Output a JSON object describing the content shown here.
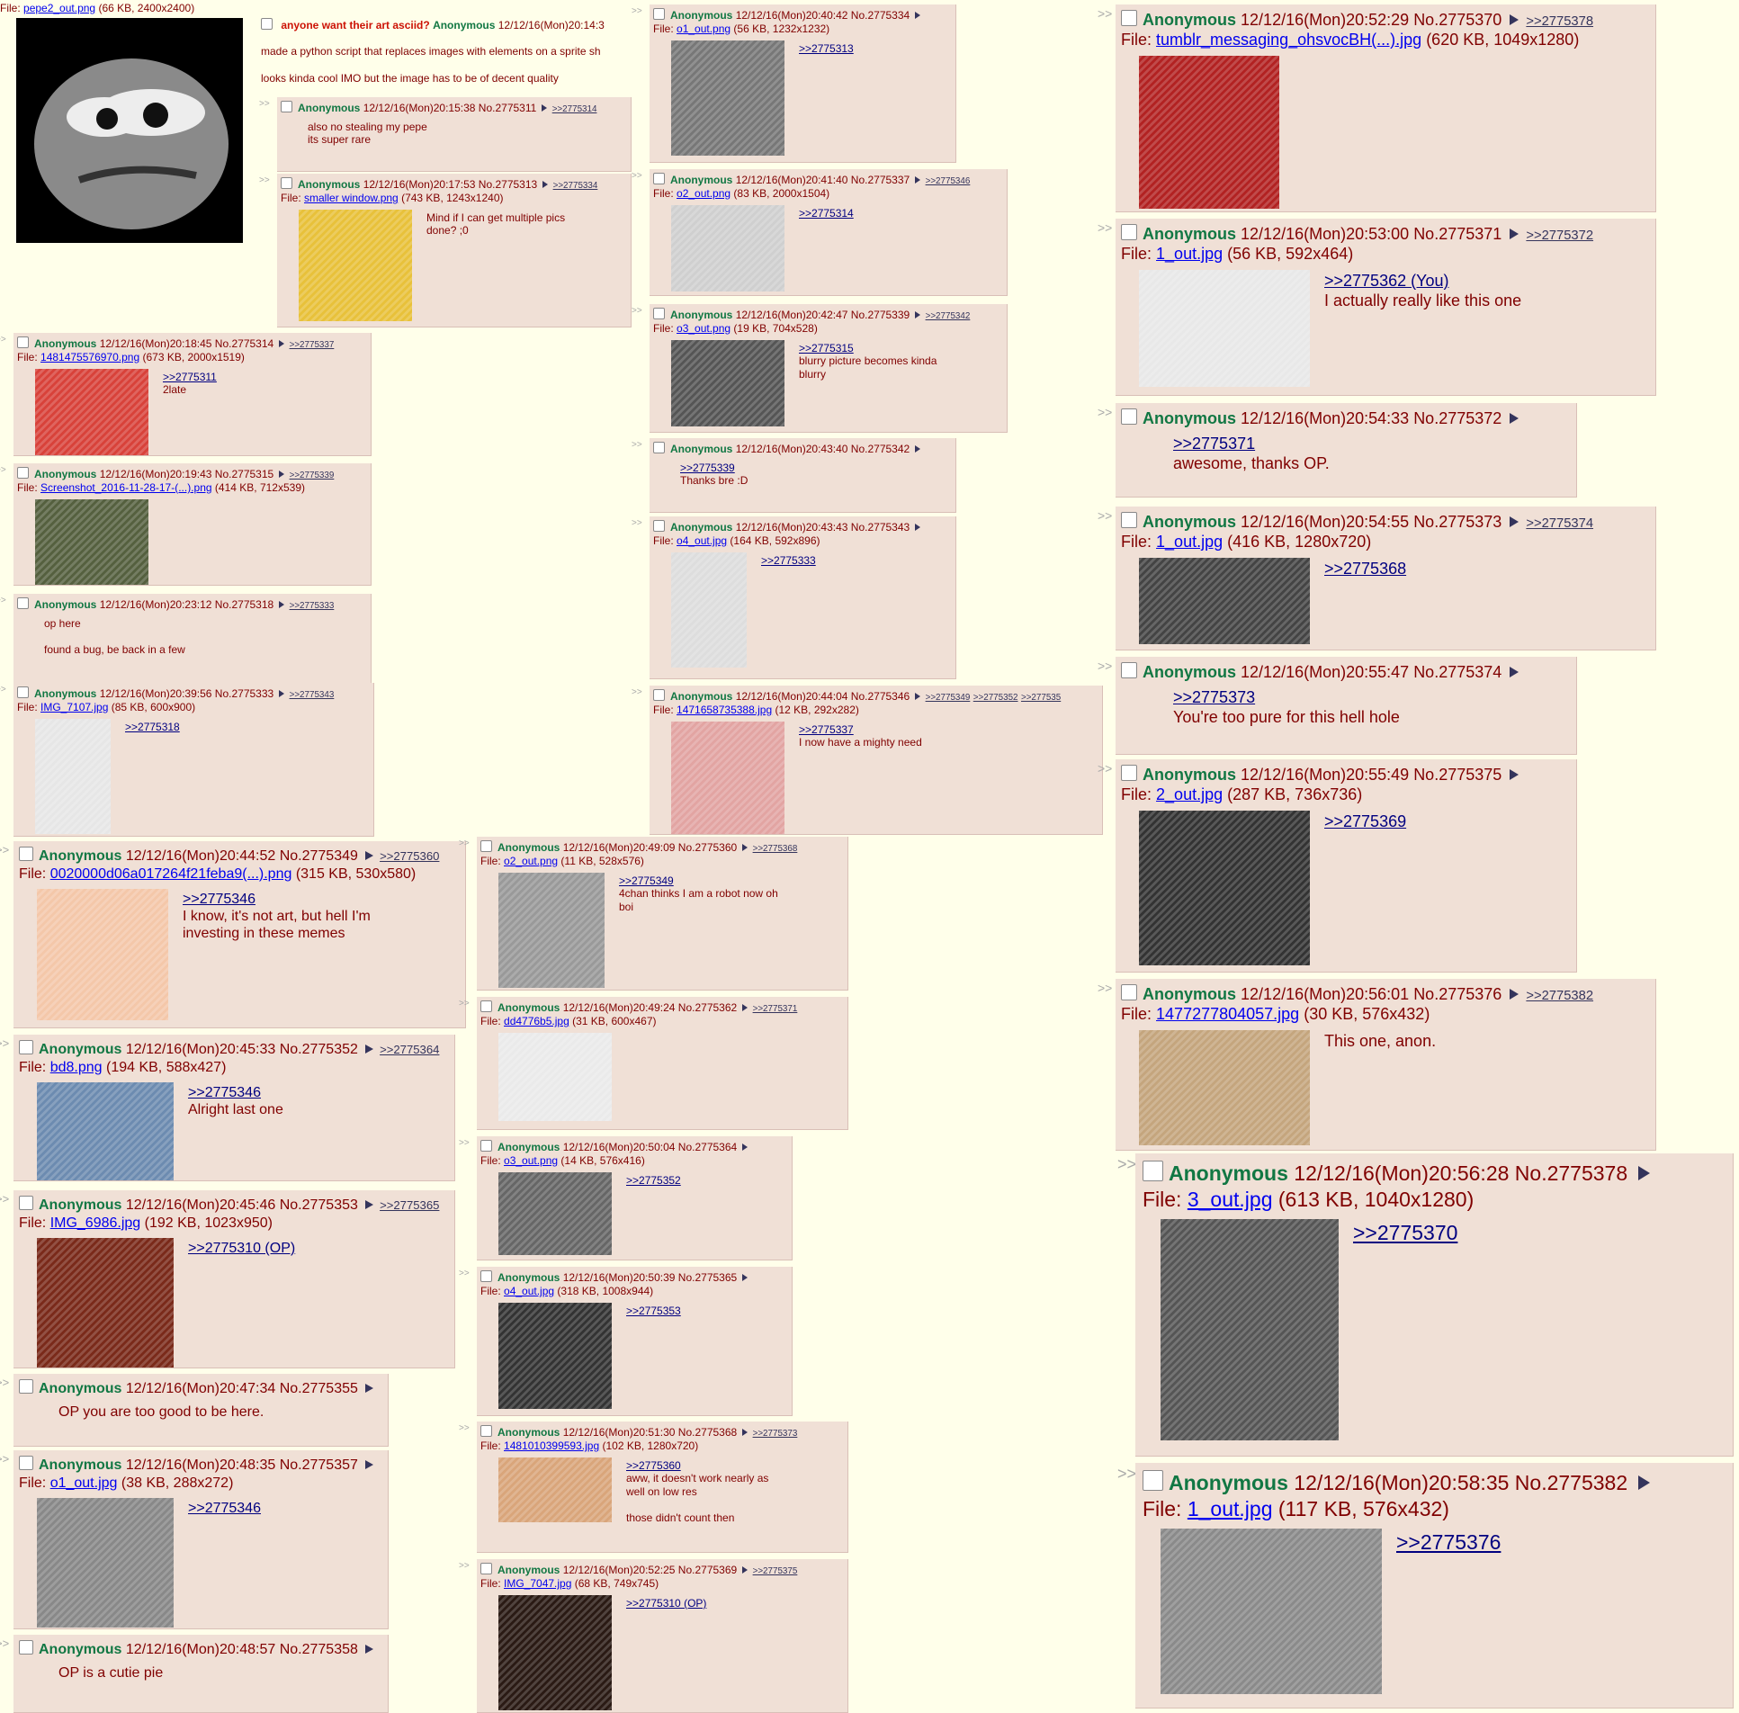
{
  "op": {
    "file_label": "File:",
    "file_name": "pepe2_out.png",
    "file_meta": "(66 KB, 2400x2400)",
    "subject": "anyone want their art asciid?",
    "name": "Anonymous",
    "date": "12/12/16(Mon)20:14:3",
    "lines": [
      "made a python script that replaces images with elements on a sprite sh",
      "looks kinda cool IMO but the image has to be of decent quality"
    ]
  },
  "colors": {
    "post_bg": "#f0e0d6",
    "name": "#117743",
    "text": "#800000",
    "link": "#34345c",
    "file_link": "#0000ee",
    "subject": "#cc1105",
    "page_bg": "#ffffea"
  },
  "posts": [
    {
      "name": "Anonymous",
      "date": "12/12/16(Mon)20:15:38",
      "no": "No.2775311",
      "backlinks": [
        ">>2775314"
      ],
      "file": null,
      "lines": [
        {
          "t": "also no stealing my pepe"
        },
        {
          "t": "its super rare"
        }
      ]
    },
    {
      "name": "Anonymous",
      "date": "12/12/16(Mon)20:17:53",
      "no": "No.2775313",
      "backlinks": [
        ">>2775334"
      ],
      "file": {
        "name": "smaller window.png",
        "meta": "(743 KB, 1243x1240)"
      },
      "lines": [
        {
          "t": "Mind if I can get multiple pics"
        },
        {
          "t": "done? ;0"
        }
      ]
    },
    {
      "name": "Anonymous",
      "date": "12/12/16(Mon)20:18:45",
      "no": "No.2775314",
      "backlinks": [
        ">>2775337"
      ],
      "file": {
        "name": "1481475576970.png",
        "meta": "(673 KB, 2000x1519)"
      },
      "lines": [
        {
          "t": ">>2775311",
          "q": true
        },
        {
          "t": "2late"
        }
      ]
    },
    {
      "name": "Anonymous",
      "date": "12/12/16(Mon)20:19:43",
      "no": "No.2775315",
      "backlinks": [
        ">>2775339"
      ],
      "file": {
        "name": "Screenshot_2016-11-28-17-(...).png",
        "meta": "(414 KB, 712x539)"
      },
      "lines": []
    },
    {
      "name": "Anonymous",
      "date": "12/12/16(Mon)20:23:12",
      "no": "No.2775318",
      "backlinks": [
        ">>2775333"
      ],
      "file": null,
      "lines": [
        {
          "t": "op here"
        },
        {
          "t": ""
        },
        {
          "t": "found a bug, be back in a few"
        }
      ]
    },
    {
      "name": "Anonymous",
      "date": "12/12/16(Mon)20:39:56",
      "no": "No.2775333",
      "backlinks": [
        ">>2775343"
      ],
      "file": {
        "name": "IMG_7107.jpg",
        "meta": "(85 KB, 600x900)"
      },
      "lines": [
        {
          "t": ">>2775318",
          "q": true
        }
      ]
    },
    {
      "name": "Anonymous",
      "date": "12/12/16(Mon)20:40:42",
      "no": "No.2775334",
      "backlinks": [],
      "file": {
        "name": "o1_out.png",
        "meta": "(56 KB, 1232x1232)"
      },
      "lines": [
        {
          "t": ">>2775313",
          "q": true
        }
      ]
    },
    {
      "name": "Anonymous",
      "date": "12/12/16(Mon)20:41:40",
      "no": "No.2775337",
      "backlinks": [
        ">>2775346"
      ],
      "file": {
        "name": "o2_out.png",
        "meta": "(83 KB, 2000x1504)"
      },
      "lines": [
        {
          "t": ">>2775314",
          "q": true
        }
      ]
    },
    {
      "name": "Anonymous",
      "date": "12/12/16(Mon)20:42:47",
      "no": "No.2775339",
      "backlinks": [
        ">>2775342"
      ],
      "file": {
        "name": "o3_out.png",
        "meta": "(19 KB, 704x528)"
      },
      "lines": [
        {
          "t": ">>2775315",
          "q": true
        },
        {
          "t": "blurry picture becomes kinda"
        },
        {
          "t": "blurry"
        }
      ]
    },
    {
      "name": "Anonymous",
      "date": "12/12/16(Mon)20:43:40",
      "no": "No.2775342",
      "backlinks": [],
      "file": null,
      "lines": [
        {
          "t": ">>2775339",
          "q": true
        },
        {
          "t": "Thanks bre :D"
        }
      ]
    },
    {
      "name": "Anonymous",
      "date": "12/12/16(Mon)20:43:43",
      "no": "No.2775343",
      "backlinks": [],
      "file": {
        "name": "o4_out.jpg",
        "meta": "(164 KB, 592x896)"
      },
      "lines": [
        {
          "t": ">>2775333",
          "q": true
        }
      ]
    },
    {
      "name": "Anonymous",
      "date": "12/12/16(Mon)20:44:04",
      "no": "No.2775346",
      "backlinks": [
        ">>2775349",
        ">>2775352",
        ">>277535"
      ],
      "file": {
        "name": "1471658735388.jpg",
        "meta": "(12 KB, 292x282)"
      },
      "lines": [
        {
          "t": ">>2775337",
          "q": true
        },
        {
          "t": "I now have a mighty need"
        }
      ]
    },
    {
      "name": "Anonymous",
      "date": "12/12/16(Mon)20:44:52",
      "no": "No.2775349",
      "backlinks": [
        ">>2775360"
      ],
      "file": {
        "name": "0020000d06a017264f21feba9(...).png",
        "meta": "(315 KB, 530x580)"
      },
      "lines": [
        {
          "t": ">>2775346",
          "q": true
        },
        {
          "t": "I know, it's not art, but hell I'm"
        },
        {
          "t": "investing in these memes"
        }
      ]
    },
    {
      "name": "Anonymous",
      "date": "12/12/16(Mon)20:45:33",
      "no": "No.2775352",
      "backlinks": [
        ">>2775364"
      ],
      "file": {
        "name": "bd8.png",
        "meta": "(194 KB, 588x427)"
      },
      "lines": [
        {
          "t": ">>2775346",
          "q": true
        },
        {
          "t": "Alright last one"
        }
      ]
    },
    {
      "name": "Anonymous",
      "date": "12/12/16(Mon)20:45:46",
      "no": "No.2775353",
      "backlinks": [
        ">>2775365"
      ],
      "file": {
        "name": "IMG_6986.jpg",
        "meta": "(192 KB, 1023x950)"
      },
      "lines": [
        {
          "t": ">>2775310 (OP)",
          "q": true
        }
      ]
    },
    {
      "name": "Anonymous",
      "date": "12/12/16(Mon)20:47:34",
      "no": "No.2775355",
      "backlinks": [],
      "file": null,
      "lines": [
        {
          "t": "OP you are too good to be here."
        }
      ]
    },
    {
      "name": "Anonymous",
      "date": "12/12/16(Mon)20:48:35",
      "no": "No.2775357",
      "backlinks": [],
      "file": {
        "name": "o1_out.jpg",
        "meta": "(38 KB, 288x272)"
      },
      "lines": [
        {
          "t": ">>2775346",
          "q": true
        }
      ]
    },
    {
      "name": "Anonymous",
      "date": "12/12/16(Mon)20:48:57",
      "no": "No.2775358",
      "backlinks": [],
      "file": null,
      "lines": [
        {
          "t": "OP is a cutie pie"
        }
      ]
    },
    {
      "name": "Anonymous",
      "date": "12/12/16(Mon)20:49:09",
      "no": "No.2775360",
      "backlinks": [
        ">>2775368"
      ],
      "file": {
        "name": "o2_out.png",
        "meta": "(11 KB, 528x576)"
      },
      "lines": [
        {
          "t": ">>2775349",
          "q": true
        },
        {
          "t": "4chan thinks I am a robot now oh"
        },
        {
          "t": "boi"
        }
      ]
    },
    {
      "name": "Anonymous",
      "date": "12/12/16(Mon)20:49:24",
      "no": "No.2775362",
      "backlinks": [
        ">>2775371"
      ],
      "file": {
        "name": "dd4776b5.jpg",
        "meta": "(31 KB, 600x467)"
      },
      "lines": []
    },
    {
      "name": "Anonymous",
      "date": "12/12/16(Mon)20:50:04",
      "no": "No.2775364",
      "backlinks": [],
      "file": {
        "name": "o3_out.png",
        "meta": "(14 KB, 576x416)"
      },
      "lines": [
        {
          "t": ">>2775352",
          "q": true
        }
      ]
    },
    {
      "name": "Anonymous",
      "date": "12/12/16(Mon)20:50:39",
      "no": "No.2775365",
      "backlinks": [],
      "file": {
        "name": "o4_out.jpg",
        "meta": "(318 KB, 1008x944)"
      },
      "lines": [
        {
          "t": ">>2775353",
          "q": true
        }
      ]
    },
    {
      "name": "Anonymous",
      "date": "12/12/16(Mon)20:51:30",
      "no": "No.2775368",
      "backlinks": [
        ">>2775373"
      ],
      "file": {
        "name": "1481010399593.jpg",
        "meta": "(102 KB, 1280x720)"
      },
      "lines": [
        {
          "t": ">>2775360",
          "q": true
        },
        {
          "t": "aww, it doesn't work nearly as"
        },
        {
          "t": "well on low res"
        },
        {
          "t": ""
        },
        {
          "t": "those didn't count then"
        }
      ]
    },
    {
      "name": "Anonymous",
      "date": "12/12/16(Mon)20:52:25",
      "no": "No.2775369",
      "backlinks": [
        ">>2775375"
      ],
      "file": {
        "name": "IMG_7047.jpg",
        "meta": "(68 KB, 749x745)"
      },
      "lines": [
        {
          "t": ">>2775310 (OP)",
          "q": true
        }
      ]
    },
    {
      "name": "Anonymous",
      "date": "12/12/16(Mon)20:52:29",
      "no": "No.2775370",
      "backlinks": [
        ">>2775378"
      ],
      "file": {
        "name": "tumblr_messaging_ohsvocBH(...).jpg",
        "meta": "(620 KB, 1049x1280)"
      },
      "lines": []
    },
    {
      "name": "Anonymous",
      "date": "12/12/16(Mon)20:53:00",
      "no": "No.2775371",
      "backlinks": [
        ">>2775372"
      ],
      "file": {
        "name": "1_out.jpg",
        "meta": "(56 KB, 592x464)"
      },
      "lines": [
        {
          "t": ">>2775362 (You)",
          "q": true
        },
        {
          "t": "I actually really like this one"
        }
      ]
    },
    {
      "name": "Anonymous",
      "date": "12/12/16(Mon)20:54:33",
      "no": "No.2775372",
      "backlinks": [],
      "file": null,
      "lines": [
        {
          "t": ">>2775371",
          "q": true
        },
        {
          "t": "awesome, thanks OP."
        }
      ]
    },
    {
      "name": "Anonymous",
      "date": "12/12/16(Mon)20:54:55",
      "no": "No.2775373",
      "backlinks": [
        ">>2775374"
      ],
      "file": {
        "name": "1_out.jpg",
        "meta": "(416 KB, 1280x720)"
      },
      "lines": [
        {
          "t": ">>2775368",
          "q": true
        }
      ]
    },
    {
      "name": "Anonymous",
      "date": "12/12/16(Mon)20:55:47",
      "no": "No.2775374",
      "backlinks": [],
      "file": null,
      "lines": [
        {
          "t": ">>2775373",
          "q": true
        },
        {
          "t": "You're too pure for this hell hole"
        }
      ]
    },
    {
      "name": "Anonymous",
      "date": "12/12/16(Mon)20:55:49",
      "no": "No.2775375",
      "backlinks": [],
      "file": {
        "name": "2_out.jpg",
        "meta": "(287 KB, 736x736)"
      },
      "lines": [
        {
          "t": ">>2775369",
          "q": true
        }
      ]
    },
    {
      "name": "Anonymous",
      "date": "12/12/16(Mon)20:56:01",
      "no": "No.2775376",
      "backlinks": [
        ">>2775382"
      ],
      "file": {
        "name": "1477277804057.jpg",
        "meta": "(30 KB, 576x432)"
      },
      "lines": [
        {
          "t": "This one, anon."
        }
      ]
    },
    {
      "name": "Anonymous",
      "date": "12/12/16(Mon)20:56:28",
      "no": "No.2775378",
      "backlinks": [],
      "file": {
        "name": "3_out.jpg",
        "meta": "(613 KB, 1040x1280)"
      },
      "lines": [
        {
          "t": ">>2775370",
          "q": true
        }
      ]
    },
    {
      "name": "Anonymous",
      "date": "12/12/16(Mon)20:58:35",
      "no": "No.2775382",
      "backlinks": [],
      "file": {
        "name": "1_out.jpg",
        "meta": "(117 KB, 576x432)"
      },
      "lines": [
        {
          "t": ">>2775376",
          "q": true
        }
      ]
    }
  ]
}
